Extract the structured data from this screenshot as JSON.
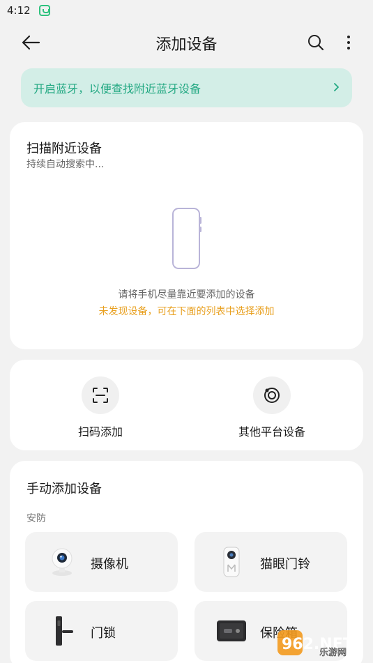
{
  "status_bar": {
    "time": "4:12"
  },
  "header": {
    "title": "添加设备"
  },
  "bluetooth_banner": {
    "text": "开启蓝牙，以便查找附近蓝牙设备"
  },
  "scan_card": {
    "title": "扫描附近设备",
    "subtitle": "持续自动搜索中...",
    "hint": "请将手机尽量靠近要添加的设备",
    "warning": "未发现设备，可在下面的列表中选择添加"
  },
  "actions": [
    {
      "label": "扫码添加",
      "icon": "scan-icon"
    },
    {
      "label": "其他平台设备",
      "icon": "platform-icon"
    }
  ],
  "manual": {
    "title": "手动添加设备",
    "category": "安防",
    "devices": [
      {
        "name": "摄像机",
        "icon": "camera-icon"
      },
      {
        "name": "猫眼门铃",
        "icon": "doorbell-icon"
      },
      {
        "name": "门锁",
        "icon": "door-lock-icon"
      },
      {
        "name": "保险箱",
        "icon": "safe-icon"
      }
    ]
  },
  "watermark": {
    "brand": "962.NET",
    "sub": "乐游网"
  },
  "colors": {
    "accent": "#22a882",
    "banner_bg": "#d3eee7",
    "warning": "#e8a020"
  }
}
